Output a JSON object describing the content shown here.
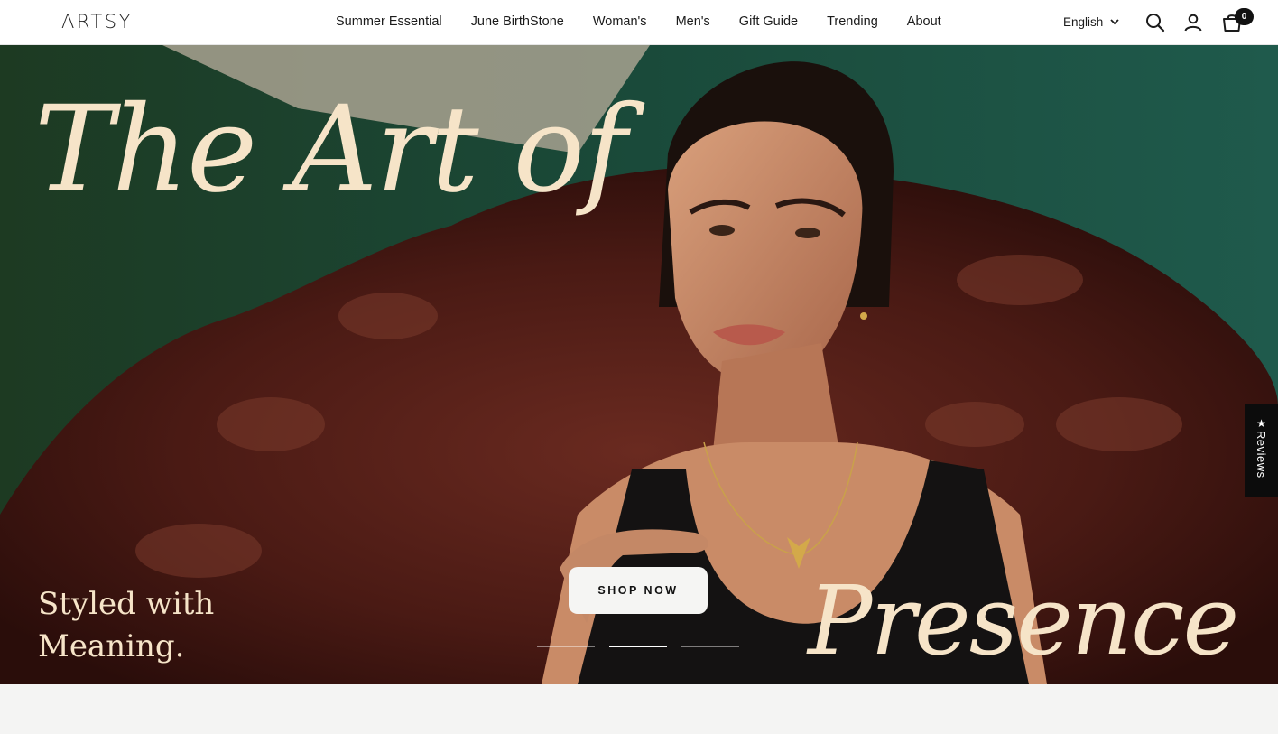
{
  "header": {
    "logo": "ARTSY",
    "nav": [
      {
        "label": "Summer Essential"
      },
      {
        "label": "June BirthStone"
      },
      {
        "label": "Woman's"
      },
      {
        "label": "Men's"
      },
      {
        "label": "Gift Guide"
      },
      {
        "label": "Trending"
      },
      {
        "label": "About"
      }
    ],
    "language": "English",
    "cart_count": "0",
    "icons": [
      "search-icon",
      "account-icon",
      "cart-icon",
      "chevron-down-icon"
    ]
  },
  "hero": {
    "headline_top": "The Art of",
    "headline_bottom": "Presence",
    "tagline_line1": "Styled with",
    "tagline_line2": "Meaning.",
    "cta": "SHOP NOW",
    "slides_total": 3,
    "active_slide": 2
  },
  "reviews_tab": {
    "icon": "star-icon",
    "label": "Reviews"
  },
  "colors": {
    "headline": "#f6e4c8",
    "leather": "#4a1a14",
    "backdrop_green": "#1f5446",
    "header_bg": "#ffffff"
  }
}
